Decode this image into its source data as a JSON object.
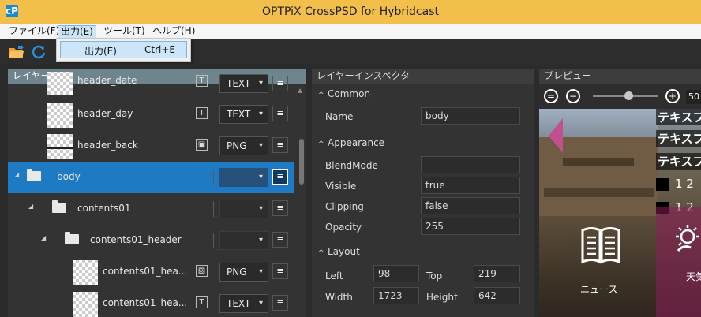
{
  "window": {
    "title": "OPTPiX CrossPSD for Hybridcast",
    "app_icon": "cP"
  },
  "menubar": {
    "items": [
      "ファイル(F)",
      "出力(E)",
      "ツール(T)",
      "ヘルプ(H)"
    ]
  },
  "dropdown": {
    "item_label": "出力(E)",
    "item_shortcut": "Ctrl+E"
  },
  "toolbar": {
    "icons": [
      "open-folder-icon",
      "refresh-icon"
    ]
  },
  "layers_panel": {
    "title": "レイヤー",
    "rows": [
      {
        "name": "header_date",
        "type_icon": "T",
        "format": "TEXT"
      },
      {
        "name": "header_day",
        "type_icon": "T",
        "format": "TEXT"
      },
      {
        "name": "header_back",
        "type_icon": "▣",
        "format": "PNG"
      },
      {
        "name": "body",
        "format": ""
      },
      {
        "name": "contents01",
        "format": ""
      },
      {
        "name": "contents01_header",
        "format": ""
      },
      {
        "name": "contents01_hea...",
        "type_icon": "▨",
        "format": "PNG"
      },
      {
        "name": "contents01_hea...",
        "type_icon": "T",
        "format": "TEXT"
      }
    ]
  },
  "inspector": {
    "title": "レイヤーインスペクタ",
    "sections": {
      "common": {
        "label": "Common",
        "name_label": "Name",
        "name_value": "body"
      },
      "appearance": {
        "label": "Appearance",
        "blendmode_label": "BlendMode",
        "blendmode_value": "",
        "visible_label": "Visible",
        "visible_value": "true",
        "clipping_label": "Clipping",
        "clipping_value": "false",
        "opacity_label": "Opacity",
        "opacity_value": "255"
      },
      "layout": {
        "label": "Layout",
        "left_label": "Left",
        "left_value": "98",
        "top_label": "Top",
        "top_value": "219",
        "width_label": "Width",
        "width_value": "1723",
        "height_label": "Height",
        "height_value": "642"
      }
    }
  },
  "preview": {
    "title": "プレビュー",
    "zoom_value": "50",
    "zoom_level": 0.55,
    "texts": [
      "テキスフ",
      "テキスフ",
      "テキスフ"
    ],
    "bullets": [
      "1 2",
      "1 2"
    ],
    "tile_news_label": "ニュース",
    "tile_weather_label": "天気"
  },
  "colors": {
    "title_bar": "#f2bf4a",
    "selected_row": "#1e7ac2",
    "panel_bg": "#333333",
    "layer_header": "#6f858e"
  }
}
